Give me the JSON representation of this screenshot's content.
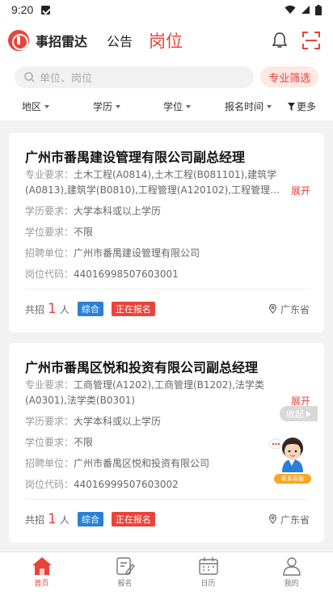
{
  "status_bar": {
    "time": "9:20"
  },
  "header": {
    "app_name": "事招雷达",
    "tabs": [
      {
        "label": "公告",
        "active": false
      },
      {
        "label": "岗位",
        "active": true
      }
    ]
  },
  "search": {
    "placeholder": "单位、岗位",
    "filter_button": "专业筛选"
  },
  "filters": [
    {
      "label": "地区"
    },
    {
      "label": "学历"
    },
    {
      "label": "学位"
    },
    {
      "label": "报名时间"
    },
    {
      "label": "更多"
    }
  ],
  "jobs": [
    {
      "title": "广州市番禺建设管理有限公司副总经理",
      "major_label": "专业要求：",
      "major_line1": "土木工程(A0814),土木工程(B081101),建筑学",
      "major_line2": "(A0813),建筑学(B0810),工程管理(A120102),工程管理…",
      "expand_label": "展开",
      "education_label": "学历要求：",
      "education": "大学本科或以上学历",
      "degree_label": "学位要求：",
      "degree": "不限",
      "employer_label": "招聘单位：",
      "employer": "广州市番禺建设管理有限公司",
      "code_label": "岗位代码：",
      "code": "44016998507603001",
      "count_prefix": "共招",
      "count": "1",
      "count_suffix": "人",
      "badges": [
        "综合",
        "正在报名"
      ],
      "location": "广东省"
    },
    {
      "title": "广州市番禺区悦和投资有限公司副总经理",
      "major_label": "专业要求：",
      "major_line1": "工商管理(A1202),工商管理(B1202),法学类",
      "major_line2": "(A0301),法学类(B0301)",
      "expand_label": "展开",
      "education_label": "学历要求：",
      "education": "大学本科或以上学历",
      "degree_label": "学位要求：",
      "degree": "不限",
      "employer_label": "招聘单位：",
      "employer": "广州市番禺区悦和投资有限公司",
      "code_label": "岗位代码：",
      "code": "44016999507603002",
      "count_prefix": "共招",
      "count": "1",
      "count_suffix": "人",
      "badges": [
        "综合",
        "正在报名"
      ],
      "location": "广东省"
    }
  ],
  "floating": {
    "collapse_label": "收起",
    "service_label": "联系客服"
  },
  "tabbar": [
    {
      "label": "首页",
      "icon": "home-icon",
      "active": true
    },
    {
      "label": "报名",
      "icon": "signup-icon",
      "active": false
    },
    {
      "label": "日历",
      "icon": "calendar-icon",
      "active": false
    },
    {
      "label": "我的",
      "icon": "profile-icon",
      "active": false
    }
  ],
  "colors": {
    "accent": "#e8443a",
    "blue_badge": "#2a80d6",
    "background": "#f2f2f2"
  }
}
